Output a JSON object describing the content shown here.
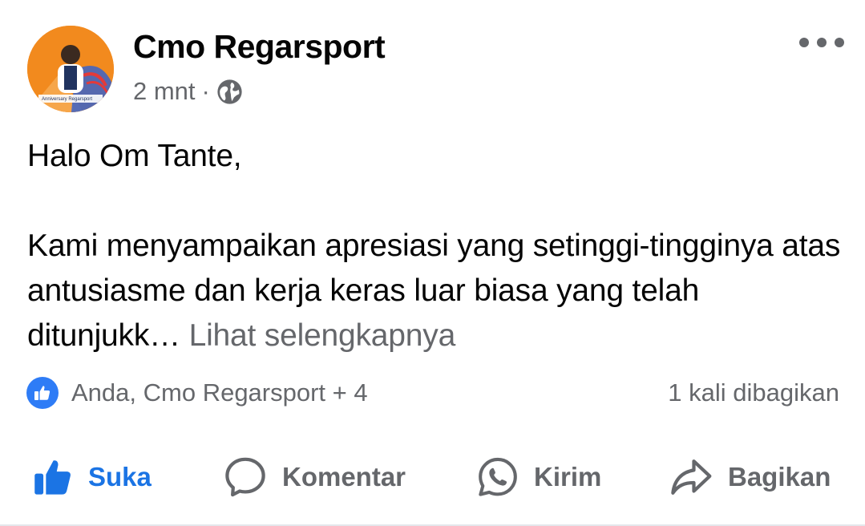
{
  "post": {
    "author": "Cmo Regarsport",
    "time": "2 mnt",
    "separator": "·",
    "privacy_icon": "globe-icon",
    "body": {
      "line1": "Halo Om Tante,",
      "paragraph2": "Kami menyampaikan apresiasi yang setinggi-tingginya atas antusiasme dan kerja keras luar biasa yang telah ditunjukk…",
      "see_more": "Lihat selengkapnya"
    },
    "reactions": {
      "icon": "like-icon",
      "text": "Anda, Cmo Regarsport + 4"
    },
    "shares": "1 kali dibagikan",
    "actions": {
      "like": "Suka",
      "comment": "Komentar",
      "send": "Kirim",
      "share": "Bagikan"
    }
  },
  "colors": {
    "accent": "#1b74e4",
    "secondary_text": "#65676b",
    "avatar_bg": "#f28a1e"
  }
}
